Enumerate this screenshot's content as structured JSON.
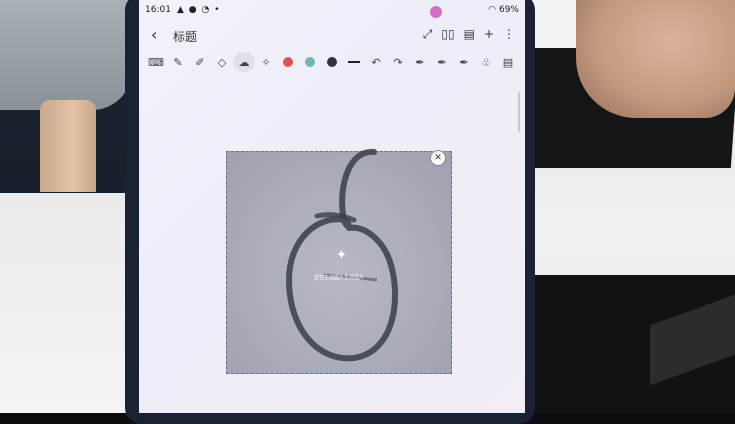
{
  "status": {
    "time": "16:01",
    "icons": "▲ ● ◔ •",
    "battery": "69%"
  },
  "header": {
    "back_icon": "‹",
    "title": "标题",
    "icons": [
      "⤢",
      "▯▯",
      "▤",
      "+",
      "⋮"
    ]
  },
  "toolbar": {
    "tools": [
      "keyboard-icon",
      "pen-icon",
      "highlighter-icon",
      "eraser-icon",
      "lasso-icon",
      "ai-spark-icon"
    ],
    "colors": [
      "#e4524f",
      "#6fb5b2",
      "#2f3340"
    ]
  },
  "image": {
    "close_glyph": "✕",
    "sparkle": "✦",
    "generating_text": "正在生成图片生成图片"
  }
}
